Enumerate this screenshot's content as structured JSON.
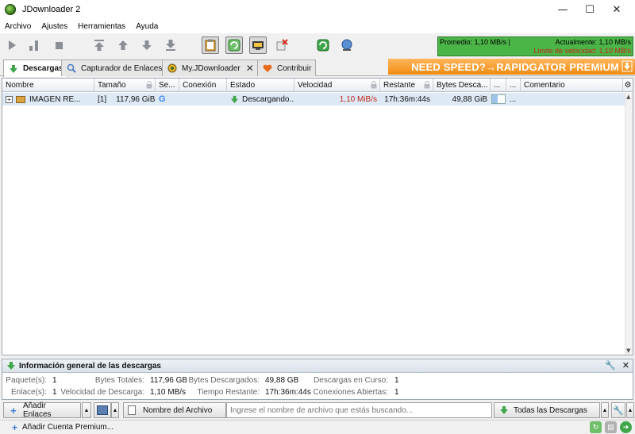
{
  "window": {
    "title": "JDownloader 2",
    "min_glyph": "—",
    "max_glyph": "☐",
    "close_glyph": "✕"
  },
  "menu": [
    "Archivo",
    "Ajustes",
    "Herramientas",
    "Ayuda"
  ],
  "toolbar": {
    "buttons": [
      "play-icon",
      "pause-icon",
      "stop-icon",
      "move-top-icon",
      "move-up-icon",
      "move-down-icon",
      "move-bottom-icon",
      "clipboard-icon",
      "auto-reconnect-icon",
      "premium-icon",
      "clear-icon",
      "reconnect-icon",
      "update-icon"
    ],
    "speed": {
      "average": "Promedio: 1,10 MB/s |",
      "current": "Actualmente: 1,10 MB/s",
      "limit": "Limite de velocidad: 1,10 MB/s"
    }
  },
  "tabs": [
    {
      "label": "Descargas",
      "icon": "download-icon",
      "active": true
    },
    {
      "label": "Capturador de Enlaces",
      "icon": "linkgrabber-icon",
      "active": false
    },
    {
      "label": "My.JDownloader",
      "icon": "myjd-icon",
      "active": false,
      "closable": true,
      "close_glyph": "✕"
    },
    {
      "label": "Contribuir",
      "icon": "heart-icon",
      "active": false
    }
  ],
  "promo": {
    "text": "NEED SPEED?→RAPIDGATOR PREMIUM"
  },
  "table": {
    "columns": [
      "Nombre",
      "Tamaño",
      "Se...",
      "Conexión",
      "Estado",
      "Velocidad",
      "Restante",
      "Bytes Desca...",
      "...",
      "...",
      "Comentario"
    ],
    "rows": [
      {
        "expander": "+",
        "name": "IMAGEN RE...",
        "count": "[1]",
        "size": "117,96 GiB",
        "host": "G",
        "status": "Descargando...",
        "speed": "1,10 MiB/s",
        "remaining": "17h:36m:44s",
        "bytes_loaded": "49,88 GiB",
        "progress_pct": 42,
        "extra": "..."
      }
    ]
  },
  "info": {
    "title": "Información general de las descargas",
    "packages_label": "Paquete(s):",
    "packages": "1",
    "links_label": "Enlace(s):",
    "links": "1",
    "total_bytes_label": "Bytes Totales:",
    "total_bytes": "117,96 GB",
    "speed_label": "Velocidad de Descarga:",
    "speed": "1,10 MB/s",
    "loaded_label": "Bytes Descargados:",
    "loaded": "49,88 GB",
    "remaining_label": "Tiempo Restante:",
    "remaining": "17h:36m:44s",
    "running_label": "Descargas en Curso:",
    "running": "1",
    "connections_label": "Conexiones Abiertas:",
    "connections": "1"
  },
  "bottom": {
    "add_links": "Añadir Enlaces",
    "filename_label": "Nombre del Archivo",
    "search_placeholder": "Ingrese el nombre de archivo que estás buscando...",
    "view_label": "Todas las Descargas"
  },
  "status": {
    "add_premium": "Añadir Cuenta Premium..."
  },
  "colors": {
    "speed_bg": "#4cb548",
    "limit_text": "#c0281d",
    "promo_bg": "#f28c12",
    "row_selected": "#dde9f5"
  }
}
